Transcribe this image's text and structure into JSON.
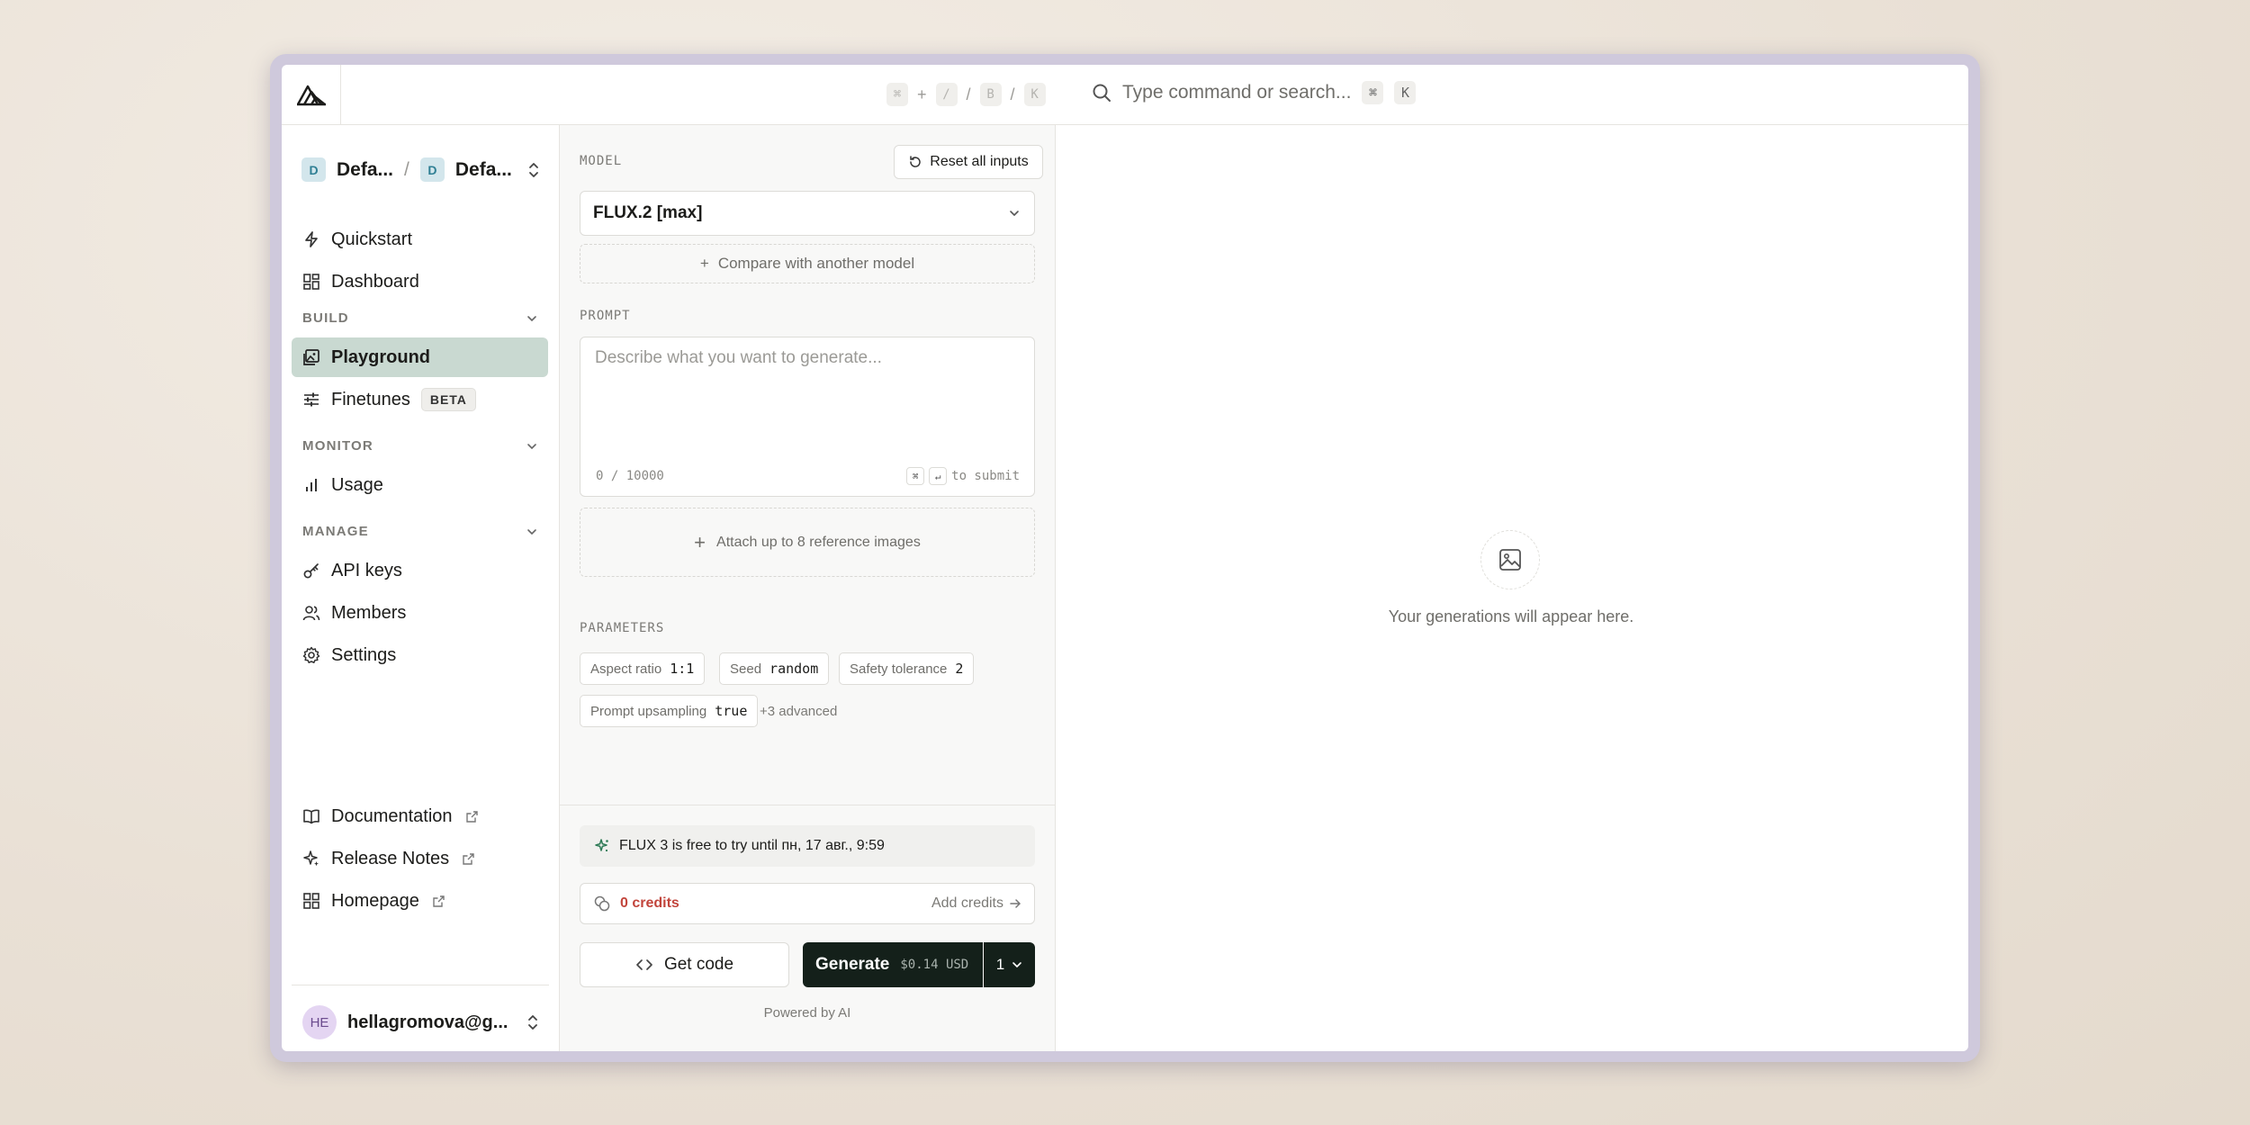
{
  "topbar": {
    "shortcut_keys": [
      "⌘",
      "+",
      "/",
      "/",
      "B",
      "/",
      "K"
    ],
    "search_placeholder": "Type command or search...",
    "search_kbd_1": "⌘",
    "search_kbd_2": "K"
  },
  "sidebar": {
    "org_avatar": "D",
    "org_name": "Defa...",
    "project_avatar": "D",
    "project_name": "Defa...",
    "separator": "/",
    "top_items": [
      {
        "label": "Quickstart",
        "icon": "bolt-icon"
      },
      {
        "label": "Dashboard",
        "icon": "grid-icon"
      }
    ],
    "sections": {
      "build": "BUILD",
      "monitor": "MONITOR",
      "manage": "MANAGE"
    },
    "build_items": [
      {
        "label": "Playground",
        "icon": "image-icon",
        "active": true
      },
      {
        "label": "Finetunes",
        "icon": "sliders-icon",
        "badge": "BETA"
      }
    ],
    "monitor_items": [
      {
        "label": "Usage",
        "icon": "bar-chart-icon"
      }
    ],
    "manage_items": [
      {
        "label": "API keys",
        "icon": "key-icon"
      },
      {
        "label": "Members",
        "icon": "users-icon"
      },
      {
        "label": "Settings",
        "icon": "gear-icon"
      }
    ],
    "footer_links": [
      {
        "label": "Documentation",
        "icon": "book-icon"
      },
      {
        "label": "Release Notes",
        "icon": "sparkle-icon"
      },
      {
        "label": "Homepage",
        "icon": "grid-icon"
      }
    ],
    "user_initials": "HE",
    "user_email": "hellagromova@g..."
  },
  "panel": {
    "model_label": "MODEL",
    "reset_label": "Reset all inputs",
    "model_value": "FLUX.2 [max]",
    "compare_label": "Compare with another model",
    "prompt_label": "PROMPT",
    "prompt_placeholder": "Describe what you want to generate...",
    "prompt_counter": "0 / 10000",
    "submit_keys": [
      "⌘",
      "↵"
    ],
    "submit_text": "to submit",
    "attach_label": "Attach up to 8 reference images",
    "parameters_label": "PARAMETERS",
    "params": [
      {
        "name": "Aspect ratio",
        "value": "1:1"
      },
      {
        "name": "Seed",
        "value": "random"
      },
      {
        "name": "Safety tolerance",
        "value": "2"
      },
      {
        "name": "Prompt upsampling",
        "value": "true"
      }
    ],
    "advanced_label": "+3 advanced",
    "promo_text": "FLUX 3 is free to try until пн, 17 авг., 9:59",
    "credits_text": "0 credits",
    "add_credits": "Add credits",
    "get_code": "Get code",
    "generate_label": "Generate",
    "generate_price": "$0.14 USD",
    "generate_count": "1",
    "powered_by": "Powered by AI"
  },
  "canvas": {
    "empty_text": "Your generations will appear here."
  },
  "colors": {
    "accent_active": "#c9d9d1",
    "generate_bg": "#14201a",
    "credits_red": "#c2453c"
  }
}
